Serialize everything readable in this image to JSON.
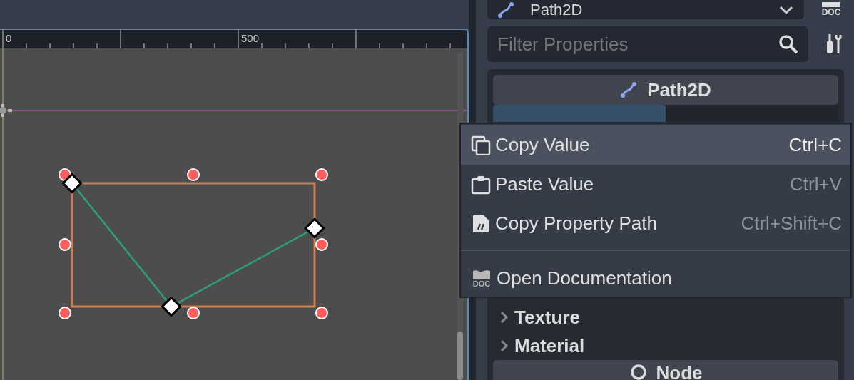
{
  "ruler": {
    "labels": [
      "0",
      "500"
    ]
  },
  "inspector": {
    "node_selector": "Path2D",
    "doc_button_text": "DOC",
    "filter": {
      "placeholder": "Filter Properties"
    },
    "class_header": "Path2D",
    "sections": [
      {
        "label": "Texture",
        "expanded": false
      },
      {
        "label": "Material",
        "expanded": false
      }
    ],
    "next_header": "Node"
  },
  "context_menu": {
    "items": [
      {
        "kind": "copy",
        "label": "Copy Value",
        "shortcut": "Ctrl+C",
        "selected": true
      },
      {
        "kind": "paste",
        "label": "Paste Value",
        "shortcut": "Ctrl+V",
        "selected": false
      },
      {
        "kind": "path",
        "label": "Copy Property Path",
        "shortcut": "Ctrl+Shift+C",
        "selected": false
      },
      {
        "kind": "separator"
      },
      {
        "kind": "doc",
        "icon_text": "DOC",
        "label": "Open Documentation",
        "selected": false
      }
    ]
  }
}
